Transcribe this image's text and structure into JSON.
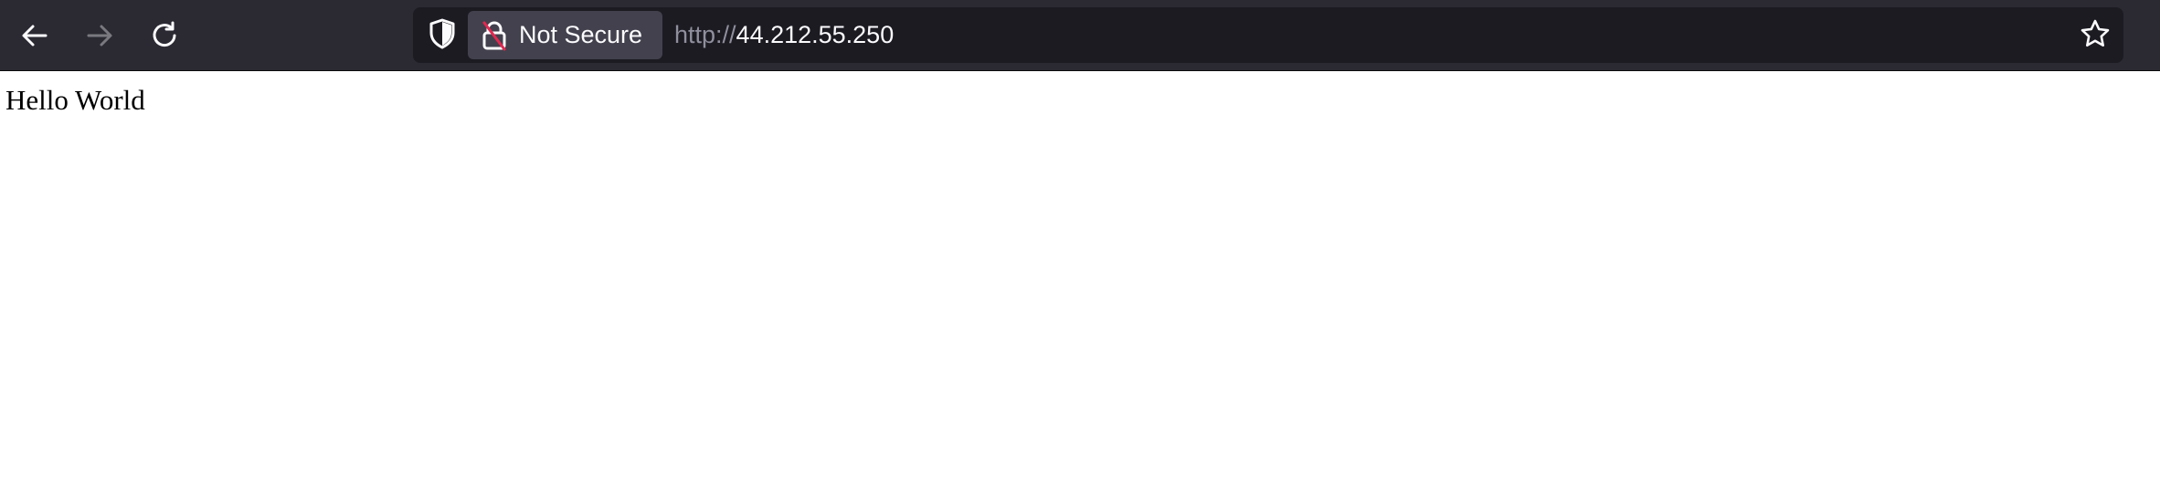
{
  "toolbar": {
    "back_icon": "arrow-left-icon",
    "forward_icon": "arrow-right-icon",
    "reload_icon": "reload-icon",
    "forward_enabled": false
  },
  "urlbar": {
    "tracking_icon": "shield-icon",
    "security_icon": "insecure-lock-icon",
    "security_label": "Not Secure",
    "url_scheme": "http://",
    "url_host": "44.212.55.250",
    "bookmark_icon": "star-icon"
  },
  "page": {
    "body_text": "Hello World"
  },
  "colors": {
    "toolbar_bg": "#2b2a33",
    "urlbar_bg": "#1c1b22",
    "pill_bg": "#42414d",
    "insecure_slash": "#e22850",
    "page_bg": "#ffffff"
  }
}
